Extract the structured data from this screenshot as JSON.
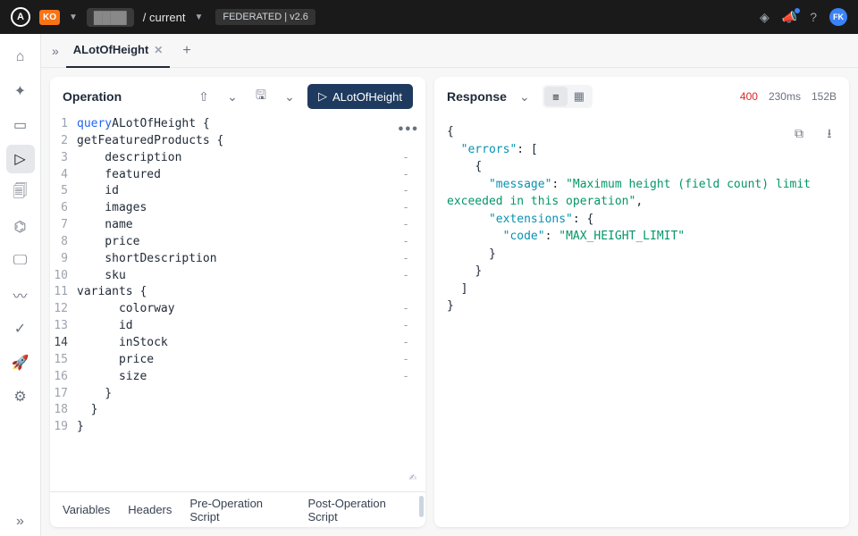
{
  "topbar": {
    "org": "KO",
    "graph": "████",
    "variant": "/ current",
    "badge": "FEDERATED | v2.6",
    "avatar": "FK"
  },
  "tabs": {
    "active": "ALotOfHeight"
  },
  "operation": {
    "title": "Operation",
    "run_label": "ALotOfHeight",
    "lines": [
      {
        "n": 1,
        "indent": 0,
        "html": "<span class='kw'>query</span> <span class='nm'>ALotOfHeight</span> {",
        "fold": false
      },
      {
        "n": 2,
        "indent": 1,
        "html": "<span class='nm'>getFeaturedProducts</span> {",
        "fold": false
      },
      {
        "n": 3,
        "indent": 2,
        "html": "description",
        "fold": true
      },
      {
        "n": 4,
        "indent": 2,
        "html": "featured",
        "fold": true
      },
      {
        "n": 5,
        "indent": 2,
        "html": "id",
        "fold": true
      },
      {
        "n": 6,
        "indent": 2,
        "html": "images",
        "fold": true
      },
      {
        "n": 7,
        "indent": 2,
        "html": "name",
        "fold": true
      },
      {
        "n": 8,
        "indent": 2,
        "html": "price",
        "fold": true
      },
      {
        "n": 9,
        "indent": 2,
        "html": "shortDescription",
        "fold": true
      },
      {
        "n": 10,
        "indent": 2,
        "html": "sku",
        "fold": true
      },
      {
        "n": 11,
        "indent": 2,
        "html": "<span class='nm'>variants</span> {",
        "fold": false
      },
      {
        "n": 12,
        "indent": 3,
        "html": "colorway",
        "fold": true
      },
      {
        "n": 13,
        "indent": 3,
        "html": "id",
        "fold": true
      },
      {
        "n": 14,
        "indent": 3,
        "html": "inStock",
        "fold": true,
        "current": true
      },
      {
        "n": 15,
        "indent": 3,
        "html": "price",
        "fold": true
      },
      {
        "n": 16,
        "indent": 3,
        "html": "size",
        "fold": true
      },
      {
        "n": 17,
        "indent": 2,
        "html": "}",
        "fold": false
      },
      {
        "n": 18,
        "indent": 1,
        "html": "}",
        "fold": false
      },
      {
        "n": 19,
        "indent": 0,
        "html": "}",
        "fold": false
      }
    ],
    "bottom_tabs": [
      "Variables",
      "Headers",
      "Pre-Operation Script",
      "Post-Operation Script"
    ]
  },
  "response": {
    "title": "Response",
    "status": "400",
    "time": "230ms",
    "size": "152B",
    "json_lines": [
      "{",
      "  \"errors\": [",
      "    {",
      "      \"message\": \"Maximum height (field count) limit exceeded in this operation\",",
      "      \"extensions\": {",
      "        \"code\": \"MAX_HEIGHT_LIMIT\"",
      "      }",
      "    }",
      "  ]",
      "}"
    ]
  }
}
